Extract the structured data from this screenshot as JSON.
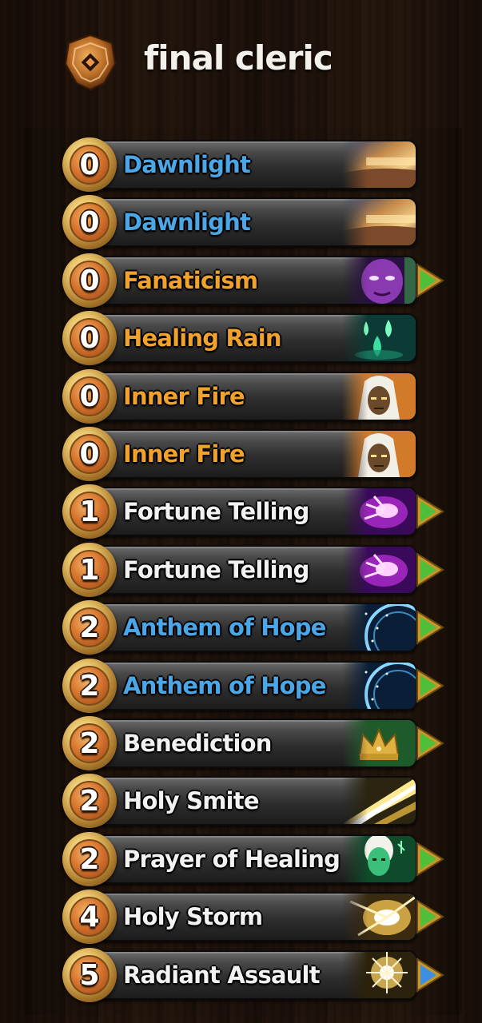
{
  "deck": {
    "title": "final cleric",
    "class_icon": "shield-crest-icon"
  },
  "colors": {
    "blue_name": "#4aa6e6",
    "orange_name": "#f0a22c",
    "white_name": "#f2f2f2",
    "green_arrow": "#4fbf3a",
    "blue_arrow": "#3f8fe0"
  },
  "cards": [
    {
      "cost": "0",
      "name": "Dawnlight",
      "name_color": "blue",
      "art": "dawn-sky-art",
      "marker": "none"
    },
    {
      "cost": "0",
      "name": "Dawnlight",
      "name_color": "blue",
      "art": "dawn-sky-art",
      "marker": "none"
    },
    {
      "cost": "0",
      "name": "Fanaticism",
      "name_color": "orange",
      "art": "purple-demon-face-art",
      "marker": "green"
    },
    {
      "cost": "0",
      "name": "Healing Rain",
      "name_color": "orange",
      "art": "green-droplets-art",
      "marker": "none"
    },
    {
      "cost": "0",
      "name": "Inner Fire",
      "name_color": "orange",
      "art": "hooded-priest-art",
      "marker": "none"
    },
    {
      "cost": "0",
      "name": "Inner Fire",
      "name_color": "orange",
      "art": "hooded-priest-art",
      "marker": "none"
    },
    {
      "cost": "1",
      "name": "Fortune Telling",
      "name_color": "white",
      "art": "purple-magic-hand-art",
      "marker": "green"
    },
    {
      "cost": "1",
      "name": "Fortune Telling",
      "name_color": "white",
      "art": "purple-magic-hand-art",
      "marker": "green"
    },
    {
      "cost": "2",
      "name": "Anthem of Hope",
      "name_color": "blue",
      "art": "starry-rune-circle-art",
      "marker": "green"
    },
    {
      "cost": "2",
      "name": "Anthem of Hope",
      "name_color": "blue",
      "art": "starry-rune-circle-art",
      "marker": "green"
    },
    {
      "cost": "2",
      "name": "Benediction",
      "name_color": "white",
      "art": "golden-crown-art",
      "marker": "green"
    },
    {
      "cost": "2",
      "name": "Holy Smite",
      "name_color": "white",
      "art": "holy-light-beam-art",
      "marker": "none"
    },
    {
      "cost": "2",
      "name": "Prayer of Healing",
      "name_color": "white",
      "art": "green-priestess-art",
      "marker": "green"
    },
    {
      "cost": "4",
      "name": "Holy Storm",
      "name_color": "white",
      "art": "holy-light-burst-art",
      "marker": "green"
    },
    {
      "cost": "5",
      "name": "Radiant Assault",
      "name_color": "white",
      "art": "radiant-explosion-art",
      "marker": "blue"
    }
  ]
}
